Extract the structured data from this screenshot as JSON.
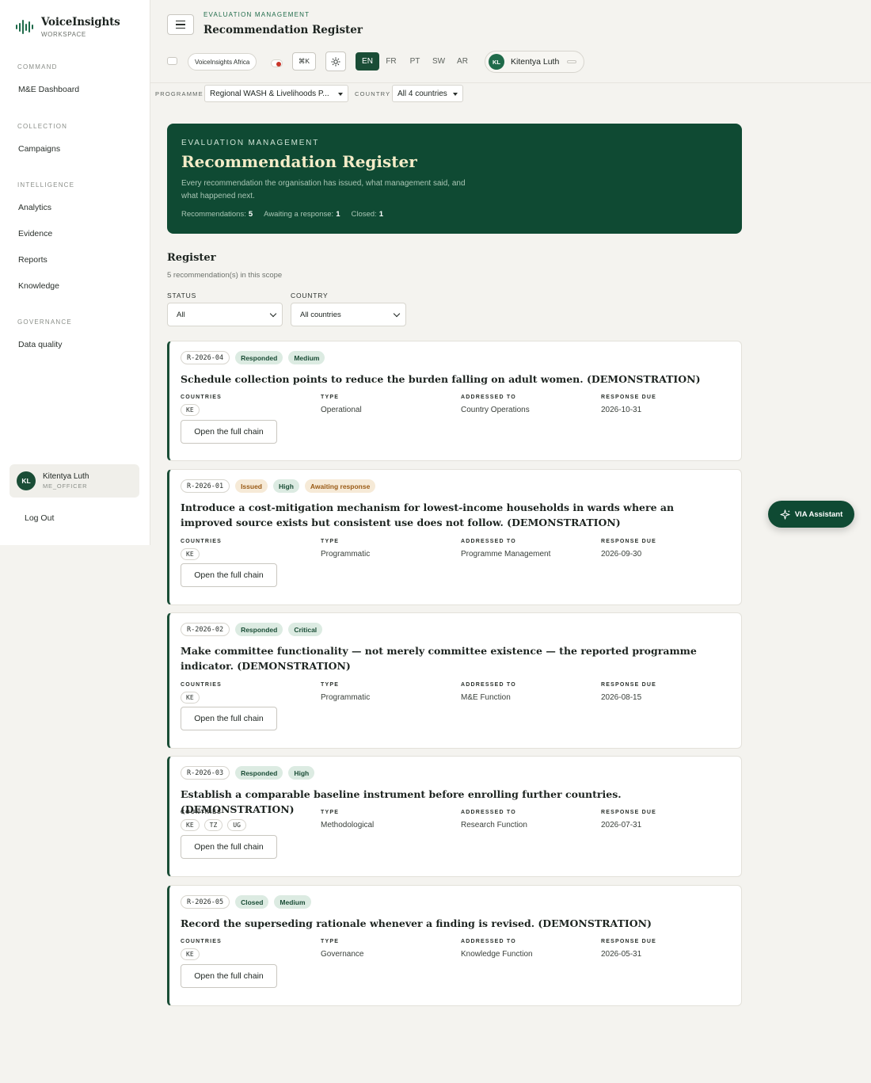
{
  "brand": {
    "name": "VoiceInsights",
    "sub": "WORKSPACE"
  },
  "sidebar": {
    "sections": [
      {
        "label": "COMMAND",
        "items": [
          "M&E Dashboard"
        ]
      },
      {
        "label": "COLLECTION",
        "items": [
          "Campaigns"
        ]
      },
      {
        "label": "INTELLIGENCE",
        "items": [
          "Analytics",
          "Evidence",
          "Reports",
          "Knowledge"
        ]
      },
      {
        "label": "GOVERNANCE",
        "items": [
          "Data quality"
        ]
      }
    ],
    "user": {
      "initials": "KL",
      "name": "Kitentya Luth",
      "role": "ME_OFFICER"
    },
    "logout": "Log Out"
  },
  "header": {
    "eyebrow": "EVALUATION MANAGEMENT",
    "title": "Recommendation Register",
    "org": "VoiceInsights Africa",
    "shortcut": "⌘K",
    "languages": [
      "EN",
      "FR",
      "PT",
      "SW",
      "AR"
    ],
    "active_language": "EN",
    "user": {
      "initials": "KL",
      "name": "Kitentya Luth"
    }
  },
  "filters_bar": {
    "programme_label": "PROGRAMME",
    "programme_value": "Regional WASH & Livelihoods P...",
    "country_label": "COUNTRY",
    "country_value": "All 4 countries"
  },
  "hero": {
    "eyebrow": "EVALUATION MANAGEMENT",
    "title": "Recommendation Register",
    "description": "Every recommendation the organisation has issued, what management said, and what happened next.",
    "stats": [
      {
        "label": "Recommendations:",
        "value": "5"
      },
      {
        "label": "Awaiting a response:",
        "value": "1"
      },
      {
        "label": "Closed:",
        "value": "1"
      }
    ]
  },
  "register": {
    "title": "Register",
    "subtitle": "5 recommendation(s) in this scope",
    "status_label": "STATUS",
    "status_value": "All",
    "country_label": "COUNTRY",
    "country_value": "All countries",
    "meta_labels": {
      "countries": "COUNTRIES",
      "type": "TYPE",
      "addressed": "ADDRESSED TO",
      "due": "RESPONSE DUE"
    },
    "open_label": "Open the full chain",
    "cards": [
      {
        "id": "R-2026-04",
        "tags": [
          {
            "text": "Responded",
            "tone": "green"
          },
          {
            "text": "Medium",
            "tone": "green"
          }
        ],
        "title": "Schedule collection points to reduce the burden falling on adult women. (DEMONSTRATION)",
        "countries": [
          "KE"
        ],
        "type": "Operational",
        "addressed_to": "Country Operations",
        "due": "2026-10-31"
      },
      {
        "id": "R-2026-01",
        "tags": [
          {
            "text": "Issued",
            "tone": "amber"
          },
          {
            "text": "High",
            "tone": "green"
          },
          {
            "text": "Awaiting response",
            "tone": "amber"
          }
        ],
        "title": "Introduce a cost-mitigation mechanism for lowest-income households in wards where an improved source exists but consistent use does not follow. (DEMONSTRATION)",
        "countries": [
          "KE"
        ],
        "type": "Programmatic",
        "addressed_to": "Programme Management",
        "due": "2026-09-30"
      },
      {
        "id": "R-2026-02",
        "tags": [
          {
            "text": "Responded",
            "tone": "green"
          },
          {
            "text": "Critical",
            "tone": "green"
          }
        ],
        "title": "Make committee functionality — not merely committee existence — the reported programme indicator. (DEMONSTRATION)",
        "countries": [
          "KE"
        ],
        "type": "Programmatic",
        "addressed_to": "M&E Function",
        "due": "2026-08-15"
      },
      {
        "id": "R-2026-03",
        "tags": [
          {
            "text": "Responded",
            "tone": "green"
          },
          {
            "text": "High",
            "tone": "green"
          }
        ],
        "title": "Establish a comparable baseline instrument before enrolling further countries. (DEMONSTRATION)",
        "countries": [
          "KE",
          "TZ",
          "UG"
        ],
        "type": "Methodological",
        "addressed_to": "Research Function",
        "due": "2026-07-31"
      },
      {
        "id": "R-2026-05",
        "tags": [
          {
            "text": "Closed",
            "tone": "green"
          },
          {
            "text": "Medium",
            "tone": "green"
          }
        ],
        "title": "Record the superseding rationale whenever a finding is revised. (DEMONSTRATION)",
        "countries": [
          "KE"
        ],
        "type": "Governance",
        "addressed_to": "Knowledge Function",
        "due": "2026-05-31"
      }
    ]
  },
  "assistant": {
    "label": "VIA Assistant"
  },
  "colors": {
    "brand_green": "#0f4a33",
    "accent_green": "#1a4d36",
    "amber": "#9a5b16",
    "record_red": "#c9362a"
  }
}
